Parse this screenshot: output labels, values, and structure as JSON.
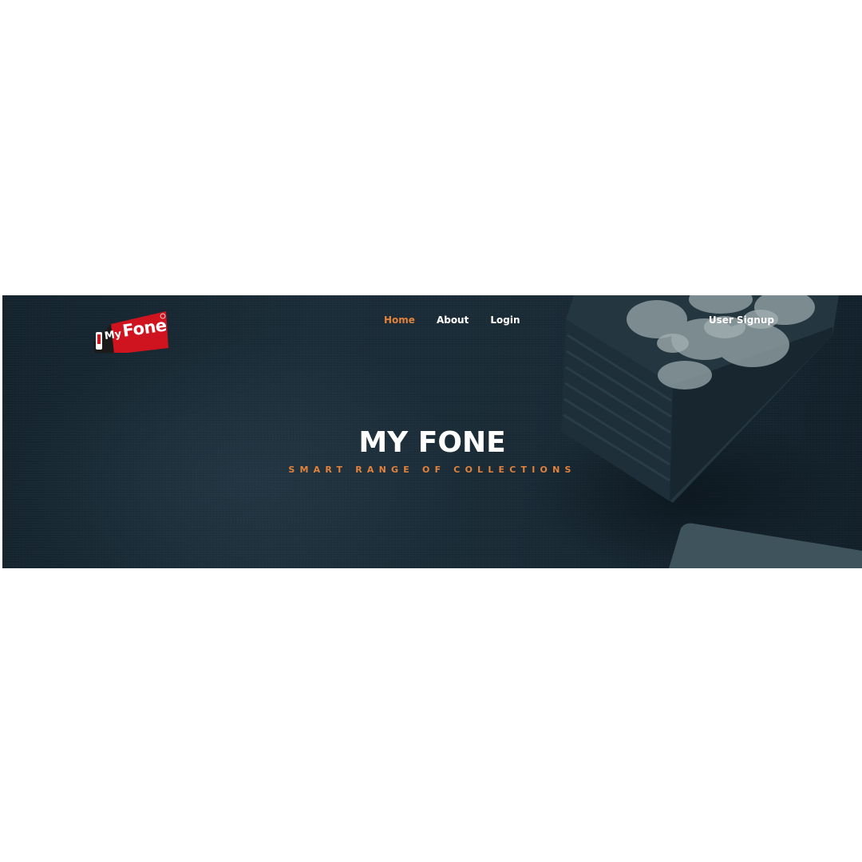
{
  "brand": {
    "logo_my": "My",
    "logo_fone": "Fone",
    "logo_color": "#d0141f"
  },
  "nav": {
    "items": [
      {
        "label": "Home",
        "active": true
      },
      {
        "label": "About",
        "active": false
      },
      {
        "label": "Login",
        "active": false
      }
    ],
    "signup_label": "User Signup"
  },
  "hero": {
    "title": "MY FONE",
    "subtitle": "SMART RANGE OF COLLECTIONS"
  },
  "colors": {
    "accent": "#e2823c",
    "hero_background": "#1a2b36",
    "text": "#ffffff",
    "page_background": "#ffffff"
  },
  "icons": [
    "phone-icon",
    "plant-pot-image"
  ]
}
